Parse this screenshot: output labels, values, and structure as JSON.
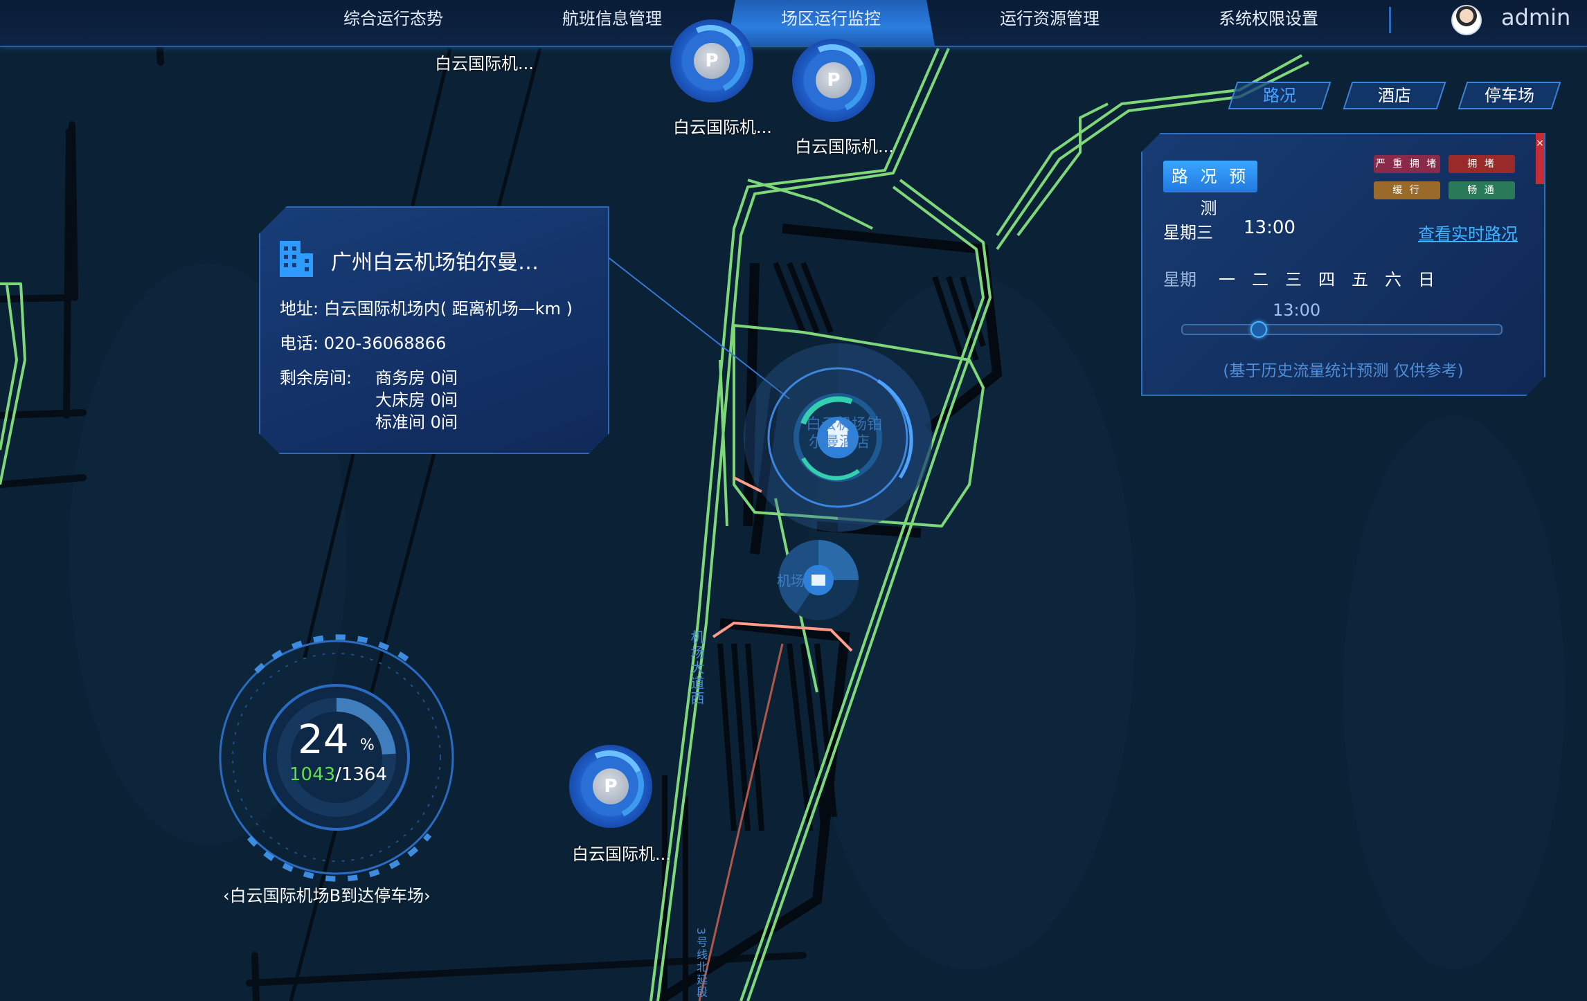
{
  "nav": {
    "items": [
      "综合运行态势",
      "航班信息管理",
      "场区运行监控",
      "运行资源管理",
      "系统权限设置"
    ],
    "active_index": 2,
    "user": "admin"
  },
  "filters": {
    "road": "路况",
    "hotel": "酒店",
    "parking": "停车场"
  },
  "traffic": {
    "title": "路 况 预 测",
    "legend": [
      {
        "label": "严 重 拥 堵",
        "color": "#8a2a4a"
      },
      {
        "label": "拥 堵",
        "color": "#9a2a2a"
      },
      {
        "label": "缓 行",
        "color": "#9a6a2a"
      },
      {
        "label": "畅 通",
        "color": "#2a7a5a"
      }
    ],
    "day": "星期三",
    "time": "13:00",
    "link": "查看实时路况",
    "week_label": "星期",
    "weekdays": [
      "一",
      "二",
      "三",
      "四",
      "五",
      "六",
      "日"
    ],
    "slider_time": "13:00",
    "slider_value": 0.24,
    "note": "(基于历史流量统计预测 仅供参考)"
  },
  "hotel_card": {
    "name": "广州白云机场铂尔曼…",
    "address": "地址: 白云国际机场内( 距离机场—km )",
    "phone": "电话: 020-36068866",
    "rooms_label": "剩余房间:",
    "rooms": [
      "商务房 0间",
      "大床房 0间",
      "标准间 0间"
    ]
  },
  "map_labels": {
    "parking_1": "白云国际机...",
    "parking_2": "白云国际机...",
    "parking_3": "白云国际机...",
    "parking_top": "白云国际机...",
    "hotel_marker": "白云机场铂尔曼酒店",
    "airport_marker": "机场",
    "road_vertical_1": "机场大道西",
    "road_vertical_2": "3号线北延段"
  },
  "parking_gauge": {
    "percent": "24",
    "percent_sign": "%",
    "used": "1043",
    "total": "/1364",
    "caption": "白云国际机场B到达停车场",
    "value": 0.24
  },
  "colors": {
    "nav_active": "#2b7de0",
    "road_normal": "#7ed87a",
    "map_bg": "#0b2236",
    "accent": "#3fb3ff"
  }
}
